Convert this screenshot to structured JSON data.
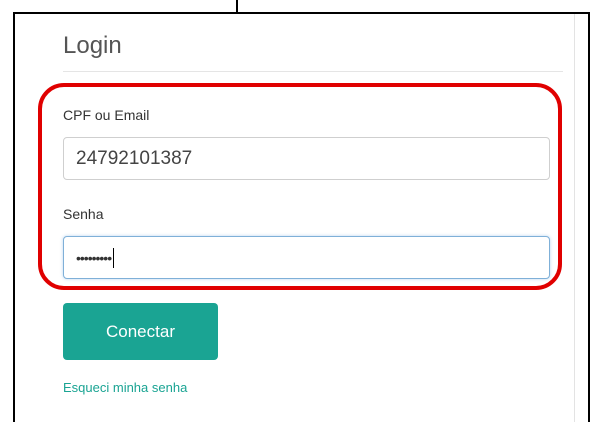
{
  "login": {
    "title": "Login",
    "username_label": "CPF ou Email",
    "username_value": "24792101387",
    "password_label": "Senha",
    "password_masked": "•••••••••",
    "submit_label": "Conectar",
    "forgot_link": "Esqueci minha senha"
  },
  "colors": {
    "accent": "#1aa493",
    "highlight": "#e00000",
    "focus_border": "#7fb0d8"
  }
}
